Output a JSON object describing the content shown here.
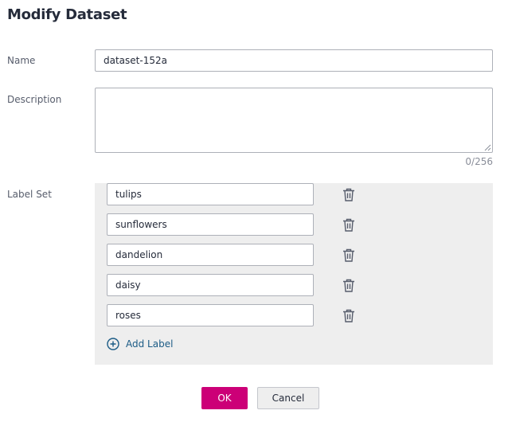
{
  "dialog": {
    "title": "Modify Dataset"
  },
  "form": {
    "name_label": "Name",
    "name_value": "dataset-152a",
    "description_label": "Description",
    "description_value": "",
    "description_counter": "0/256",
    "label_set_label": "Label Set",
    "labels": [
      {
        "value": "tulips"
      },
      {
        "value": "sunflowers"
      },
      {
        "value": "dandelion"
      },
      {
        "value": "daisy"
      },
      {
        "value": "roses"
      }
    ],
    "add_label": "Add Label"
  },
  "buttons": {
    "ok": "OK",
    "cancel": "Cancel"
  },
  "icons": {
    "delete": "trash-icon",
    "add": "plus-circle-icon"
  },
  "colors": {
    "primary": "#cc0077",
    "link": "#1b5b85",
    "panel_bg": "#eeeeee"
  }
}
